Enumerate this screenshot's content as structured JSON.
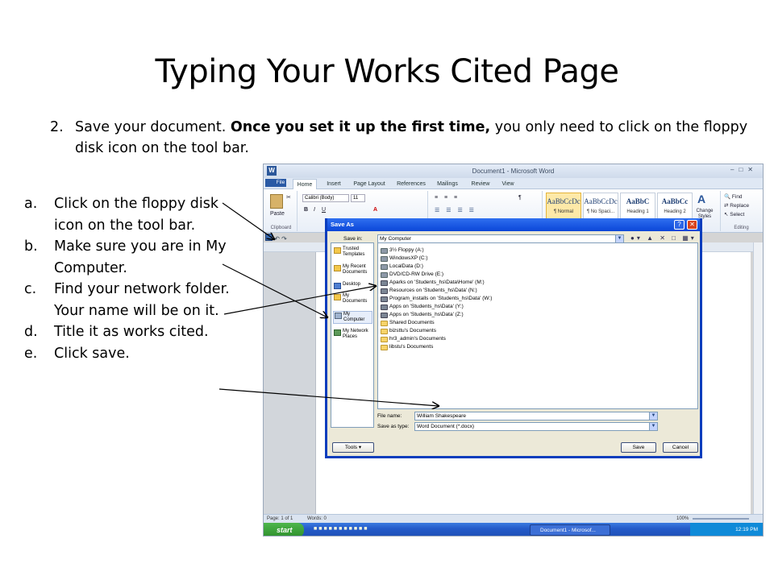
{
  "slide": {
    "title": "Typing Your Works Cited Page",
    "step2": {
      "number": "2.",
      "text_before": "Save your document. ",
      "bold": "Once you set it up the first time,",
      "text_after": " you only need to click on the floppy disk icon on the tool bar."
    },
    "substeps": [
      {
        "letter": "a.",
        "text": "Click on the floppy disk icon on the tool bar."
      },
      {
        "letter": "b.",
        "text": "Make sure you are in My Computer."
      },
      {
        "letter": "c.",
        "text": "Find your network folder. Your name will be on it."
      },
      {
        "letter": "d.",
        "text": "Title it as works cited."
      },
      {
        "letter": "e.",
        "text": "Click save."
      }
    ]
  },
  "word": {
    "window_title": "Document1 - Microsoft Word",
    "tabs": [
      "File",
      "Home",
      "Insert",
      "Page Layout",
      "References",
      "Mailings",
      "Review",
      "View"
    ],
    "active_tab": "Home",
    "font_name": "Calibri (Body)",
    "font_size": "11",
    "paste_label": "Paste",
    "clipboard_label": "Clipboard",
    "styles": [
      {
        "sample": "AaBbCcDc",
        "name": "¶ Normal"
      },
      {
        "sample": "AaBbCcDc",
        "name": "¶ No Spaci..."
      },
      {
        "sample": "AaBbC",
        "name": "Heading 1"
      },
      {
        "sample": "AaBbCc",
        "name": "Heading 2"
      }
    ],
    "change_styles_label": "Change Styles",
    "editing": {
      "find": "Find",
      "replace": "Replace",
      "select": "Select",
      "label": "Editing"
    },
    "status_page": "Page: 1 of 1",
    "status_words": "Words: 0",
    "zoom": "100%"
  },
  "dialog": {
    "title": "Save As",
    "save_in_label": "Save in:",
    "save_in_value": "My Computer",
    "places": [
      "Trusted Templates",
      "My Recent Documents",
      "Desktop",
      "My Documents",
      "My Computer",
      "My Network Places"
    ],
    "selected_place": "My Computer",
    "files": [
      {
        "name": "3½ Floppy (A:)",
        "type": "drive"
      },
      {
        "name": "WindowsXP (C:)",
        "type": "drive"
      },
      {
        "name": "LocalData (D:)",
        "type": "drive"
      },
      {
        "name": "DVD/CD-RW Drive (E:)",
        "type": "drive"
      },
      {
        "name": "Aparks on 'Students_hs\\Data\\Home' (M:)",
        "type": "net"
      },
      {
        "name": "Resources on 'Students_hs\\Data' (N:)",
        "type": "net"
      },
      {
        "name": "Program_installs on 'Students_hs\\Data' (W:)",
        "type": "net"
      },
      {
        "name": "Apps on 'Students_hs\\Data' (Y:)",
        "type": "net"
      },
      {
        "name": "Apps on 'Students_hs\\Data' (Z:)",
        "type": "net"
      },
      {
        "name": "Shared Documents",
        "type": "folder"
      },
      {
        "name": "bizsttu's Documents",
        "type": "folder"
      },
      {
        "name": "hr3_admin's Documents",
        "type": "folder"
      },
      {
        "name": "libstu's Documents",
        "type": "folder"
      }
    ],
    "file_name_label": "File name:",
    "file_name_value": "William Shakespeare",
    "save_type_label": "Save as type:",
    "save_type_value": "Word Document (*.docx)",
    "tools_label": "Tools",
    "save_button": "Save",
    "cancel_button": "Cancel"
  },
  "taskbar": {
    "start_label": "start",
    "task_label": "Document1 - Microsof...",
    "clock": "12:19 PM"
  }
}
